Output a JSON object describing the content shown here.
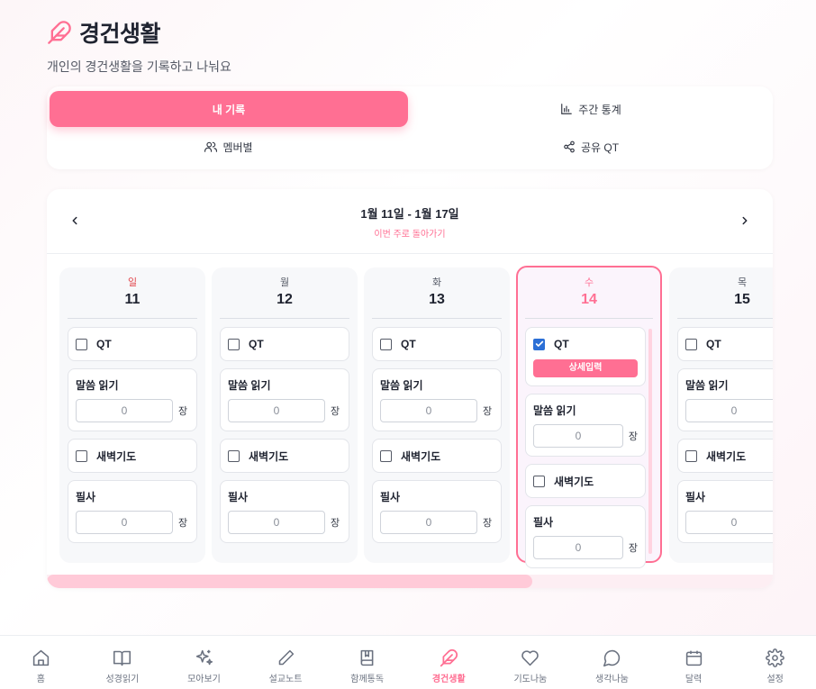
{
  "page": {
    "title": "경건생활",
    "subtitle": "개인의 경건생활을 기록하고 나눠요",
    "accent": "#ff6f93"
  },
  "tabs": [
    {
      "label": "내 기록",
      "icon": "none",
      "active": true
    },
    {
      "label": "주간 통계",
      "icon": "bar-chart-icon",
      "active": false
    },
    {
      "label": "멤버별",
      "icon": "users-icon",
      "active": false
    },
    {
      "label": "공유 QT",
      "icon": "share-icon",
      "active": false
    }
  ],
  "calendar": {
    "week_range": "1월 11일 - 1월 17일",
    "this_week_link": "이번 주로 돌아가기",
    "days": [
      {
        "dow": "일",
        "date": "11",
        "qt_checked": false,
        "reading": "0",
        "copy": "0"
      },
      {
        "dow": "월",
        "date": "12",
        "qt_checked": false,
        "reading": "0",
        "copy": "0"
      },
      {
        "dow": "화",
        "date": "13",
        "qt_checked": false,
        "reading": "0",
        "copy": "0"
      },
      {
        "dow": "수",
        "date": "14",
        "qt_checked": true,
        "reading": "0",
        "copy": "0",
        "today": true
      },
      {
        "dow": "목",
        "date": "15",
        "qt_checked": false,
        "reading": "0",
        "copy": "0"
      }
    ],
    "labels": {
      "qt": "QT",
      "detail_button": "상세입력",
      "reading": "말씀 읽기",
      "dawn_prayer": "새벽기도",
      "copy": "필사",
      "unit": "장"
    }
  },
  "bottom_nav": [
    {
      "label": "홈",
      "icon": "home-icon"
    },
    {
      "label": "성경읽기",
      "icon": "book-open-icon"
    },
    {
      "label": "모아보기",
      "icon": "sparkles-icon"
    },
    {
      "label": "설교노트",
      "icon": "pen-icon"
    },
    {
      "label": "함께통독",
      "icon": "book-icon"
    },
    {
      "label": "경건생활",
      "icon": "feather-icon",
      "active": true
    },
    {
      "label": "기도나눔",
      "icon": "heart-icon"
    },
    {
      "label": "생각나눔",
      "icon": "chat-icon"
    },
    {
      "label": "달력",
      "icon": "calendar-icon"
    },
    {
      "label": "설정",
      "icon": "gear-icon"
    }
  ]
}
